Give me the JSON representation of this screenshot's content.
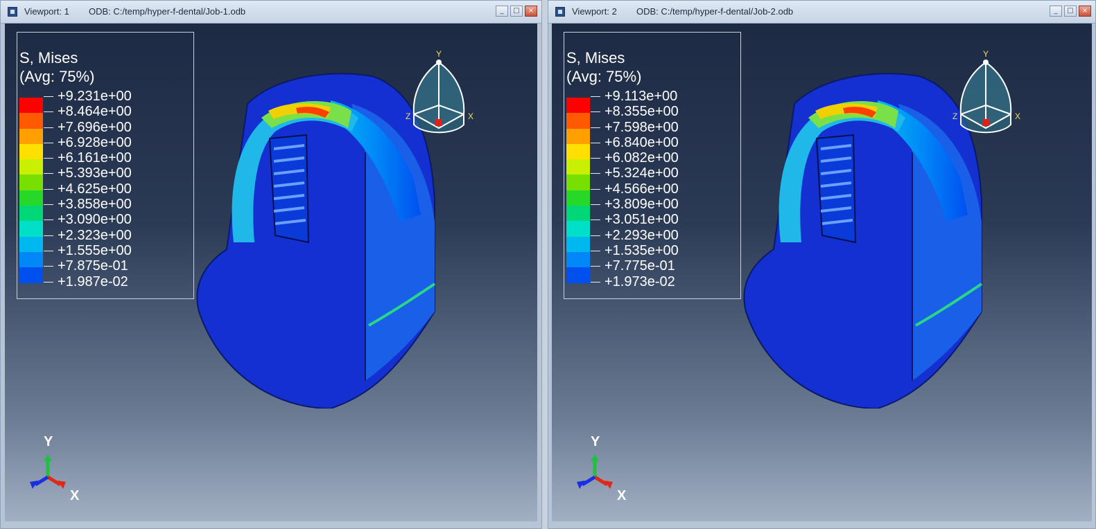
{
  "viewports": [
    {
      "title": "Viewport: 1",
      "odb": "ODB: C:/temp/hyper-f-dental/Job-1.odb",
      "legend": {
        "title": "S, Mises",
        "avg": "(Avg: 75%)",
        "values": [
          "+9.231e+00",
          "+8.464e+00",
          "+7.696e+00",
          "+6.928e+00",
          "+6.161e+00",
          "+5.393e+00",
          "+4.625e+00",
          "+3.858e+00",
          "+3.090e+00",
          "+2.323e+00",
          "+1.555e+00",
          "+7.875e-01",
          "+1.987e-02"
        ]
      },
      "triad": {
        "y": "Y",
        "z": "Z",
        "x": "X"
      },
      "viewcube": {
        "y": "Y",
        "z": "Z",
        "x": "X"
      }
    },
    {
      "title": "Viewport: 2",
      "odb": "ODB: C:/temp/hyper-f-dental/Job-2.odb",
      "legend": {
        "title": "S, Mises",
        "avg": "(Avg: 75%)",
        "values": [
          "+9.113e+00",
          "+8.355e+00",
          "+7.598e+00",
          "+6.840e+00",
          "+6.082e+00",
          "+5.324e+00",
          "+4.566e+00",
          "+3.809e+00",
          "+3.051e+00",
          "+2.293e+00",
          "+1.535e+00",
          "+7.775e-01",
          "+1.973e-02"
        ]
      },
      "triad": {
        "y": "Y",
        "z": "Z",
        "x": "X"
      },
      "viewcube": {
        "y": "Y",
        "z": "Z",
        "x": "X"
      }
    }
  ],
  "window_buttons": [
    "_",
    "□",
    "×"
  ],
  "colors": {
    "contour": [
      "#ff0000",
      "#ff5a00",
      "#ffa000",
      "#ffe000",
      "#c8f000",
      "#78e000",
      "#28d828",
      "#00d878",
      "#00e0c8",
      "#00b8f0",
      "#0088f8",
      "#0050f0",
      "#0000f0"
    ],
    "model_base": "#1535d8",
    "background_top": "#1d2a44",
    "background_bottom": "#a2b0c3"
  }
}
